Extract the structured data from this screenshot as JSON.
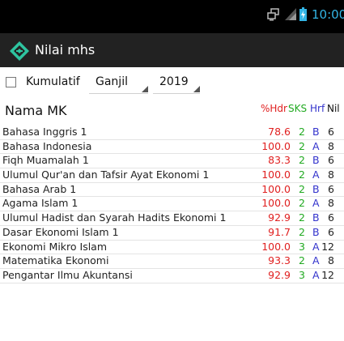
{
  "status_bar": {
    "time": "10:00",
    "icons": [
      "network-icon",
      "signal-icon",
      "battery-charging-icon"
    ],
    "accent": "#33b5e5"
  },
  "action_bar": {
    "title": "Nilai mhs",
    "logo_icon": "app-logo-icon",
    "logo_color": "#2ec4a0"
  },
  "filters": {
    "kumulatif_label": "Kumulatif",
    "kumulatif_checked": false,
    "semester": "Ganjil",
    "year": "2019"
  },
  "table": {
    "header": {
      "name": "Nama MK",
      "pct": "%Hdr",
      "sks": "SKS",
      "hrf": "Hrf",
      "nil": "Nil"
    },
    "colors": {
      "pct": "#e02020",
      "sks": "#22aa22",
      "hrf": "#3333cc"
    },
    "rows": [
      {
        "name": "Bahasa Inggris 1",
        "pct": "78.6",
        "sks": "2",
        "hrf": "B",
        "nil": "6"
      },
      {
        "name": "Bahasa Indonesia",
        "pct": "100.0",
        "sks": "2",
        "hrf": "A",
        "nil": "8"
      },
      {
        "name": "Fiqh Muamalah 1",
        "pct": "83.3",
        "sks": "2",
        "hrf": "B",
        "nil": "6"
      },
      {
        "name": "Ulumul Qur'an dan Tafsir Ayat Ekonomi 1",
        "pct": "100.0",
        "sks": "2",
        "hrf": "A",
        "nil": "8"
      },
      {
        "name": "Bahasa Arab 1",
        "pct": "100.0",
        "sks": "2",
        "hrf": "B",
        "nil": "6"
      },
      {
        "name": "Agama Islam 1",
        "pct": "100.0",
        "sks": "2",
        "hrf": "A",
        "nil": "8"
      },
      {
        "name": "Ulumul Hadist dan Syarah Hadits Ekonomi 1",
        "pct": "92.9",
        "sks": "2",
        "hrf": "B",
        "nil": "6"
      },
      {
        "name": "Dasar Ekonomi Islam 1",
        "pct": "91.7",
        "sks": "2",
        "hrf": "B",
        "nil": "6"
      },
      {
        "name": "Ekonomi Mikro Islam",
        "pct": "100.0",
        "sks": "3",
        "hrf": "A",
        "nil": "12"
      },
      {
        "name": "Matematika Ekonomi",
        "pct": "93.3",
        "sks": "2",
        "hrf": "A",
        "nil": "8"
      },
      {
        "name": "Pengantar Ilmu Akuntansi",
        "pct": "92.9",
        "sks": "3",
        "hrf": "A",
        "nil": "12"
      }
    ]
  }
}
